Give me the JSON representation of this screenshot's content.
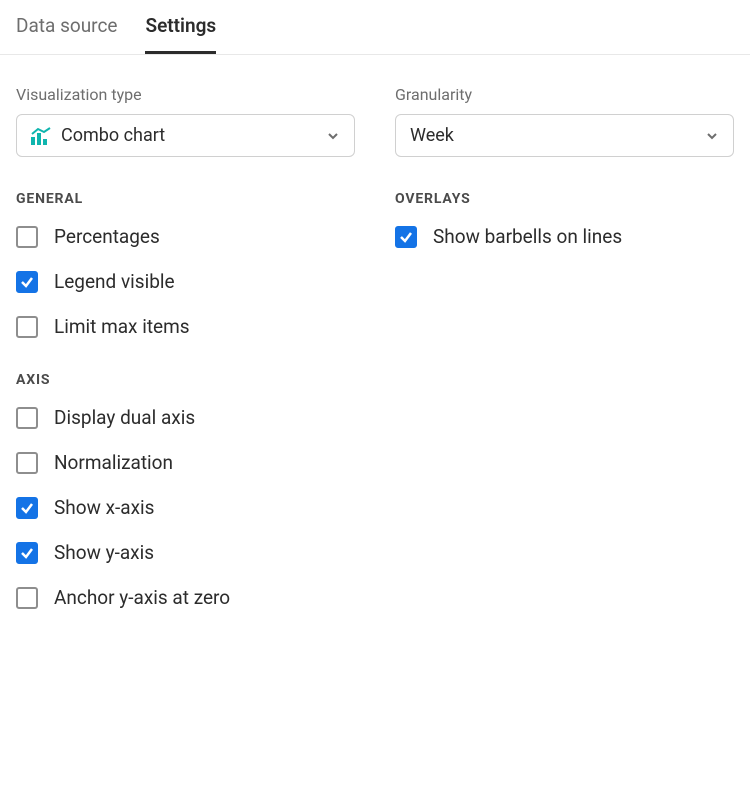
{
  "tabs": {
    "data_source": "Data source",
    "settings": "Settings"
  },
  "vis_type": {
    "label": "Visualization type",
    "value": "Combo chart"
  },
  "granularity": {
    "label": "Granularity",
    "value": "Week"
  },
  "sections": {
    "general": "General",
    "axis": "Axis",
    "overlays": "Overlays"
  },
  "checkboxes": {
    "percentages": {
      "label": "Percentages",
      "checked": false
    },
    "legend_visible": {
      "label": "Legend visible",
      "checked": true
    },
    "limit_max_items": {
      "label": "Limit max items",
      "checked": false
    },
    "display_dual_axis": {
      "label": "Display dual axis",
      "checked": false
    },
    "normalization": {
      "label": "Normalization",
      "checked": false
    },
    "show_x_axis": {
      "label": "Show x-axis",
      "checked": true
    },
    "show_y_axis": {
      "label": "Show y-axis",
      "checked": true
    },
    "anchor_y_zero": {
      "label": "Anchor y-axis at zero",
      "checked": false
    },
    "show_barbells": {
      "label": "Show barbells on lines",
      "checked": true
    }
  }
}
